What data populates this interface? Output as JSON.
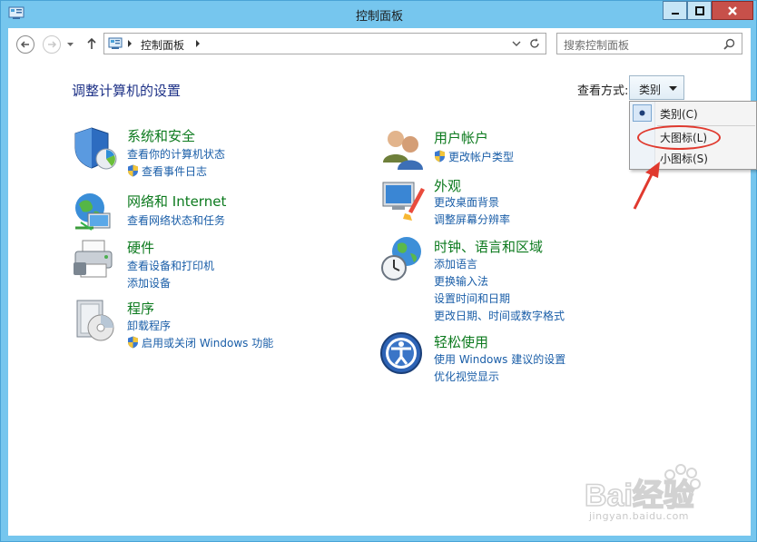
{
  "window": {
    "title": "控制面板"
  },
  "navbar": {
    "address_text": "控制面板",
    "search_placeholder": "搜索控制面板"
  },
  "content": {
    "heading": "调整计算机的设置",
    "view_by_label": "查看方式:",
    "view_by_value": "类别"
  },
  "view_menu": {
    "items": [
      {
        "label": "类别(C)",
        "checked": true
      },
      {
        "label": "大图标(L)",
        "checked": false
      },
      {
        "label": "小图标(S)",
        "checked": false
      }
    ]
  },
  "categories": [
    {
      "title": "系统和安全",
      "links": [
        "查看你的计算机状态",
        "查看事件日志"
      ],
      "icon": "shield-icon"
    },
    {
      "title": "网络和 Internet",
      "links": [
        "查看网络状态和任务"
      ],
      "icon": "globe-network-icon"
    },
    {
      "title": "硬件",
      "links": [
        "查看设备和打印机",
        "添加设备"
      ],
      "icon": "printer-icon"
    },
    {
      "title": "程序",
      "links": [
        "卸载程序",
        "启用或关闭 Windows 功能"
      ],
      "icon": "program-disc-icon"
    },
    {
      "title": "用户帐户",
      "links": [
        "更改帐户类型"
      ],
      "icon": "users-icon"
    },
    {
      "title": "外观",
      "links": [
        "更改桌面背景",
        "调整屏幕分辨率"
      ],
      "icon": "appearance-icon"
    },
    {
      "title": "时钟、语言和区域",
      "links": [
        "添加语言",
        "更换输入法",
        "设置时间和日期",
        "更改日期、时间或数字格式"
      ],
      "icon": "clock-globe-icon"
    },
    {
      "title": "轻松使用",
      "links": [
        "使用 Windows 建议的设置",
        "优化视觉显示"
      ],
      "icon": "ease-of-access-icon"
    }
  ],
  "watermark": {
    "brand": "Bai经验",
    "url": "jingyan.baidu.com"
  },
  "colors": {
    "frame": "#76c6ee",
    "category_title": "#0c7a1e",
    "link": "#1a5ea8",
    "heading": "#1e3287",
    "annotation_red": "#e0392e"
  }
}
